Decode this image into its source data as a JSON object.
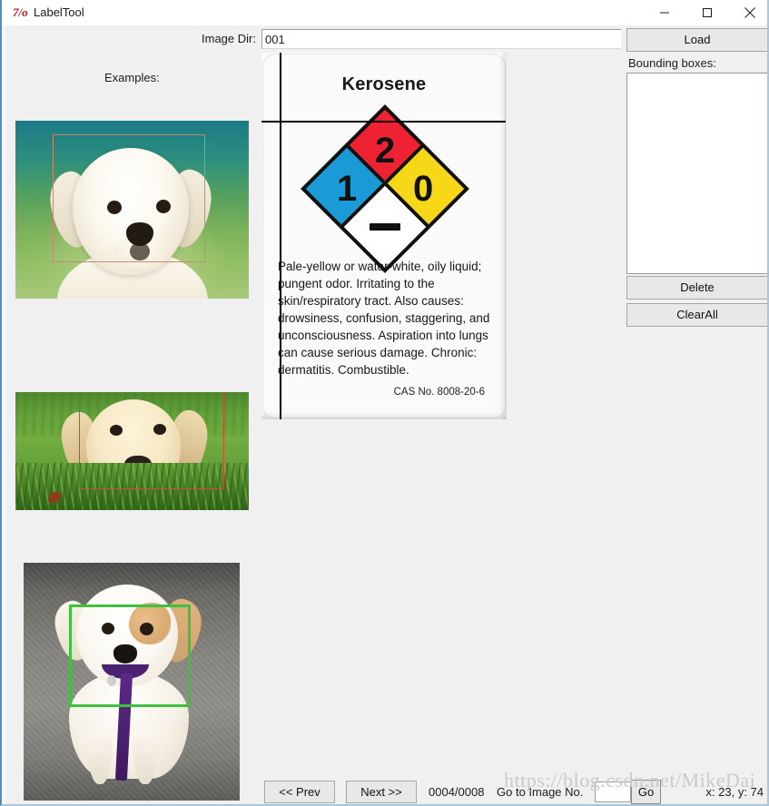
{
  "window": {
    "title": "LabelTool",
    "icon": "tk-logo-icon",
    "controls": {
      "minimize": "minimize-icon",
      "maximize": "maximize-icon",
      "close": "close-icon"
    }
  },
  "toolbar": {
    "dir_label": "Image Dir:",
    "dir_value": "001",
    "dir_placeholder": "",
    "load_label": "Load"
  },
  "examples": {
    "heading": "Examples:",
    "thumbnails": [
      {
        "name": "white-puppy-teal-background",
        "bbox_color": "#c98a6e",
        "alt": "White puppy on teal and green background with salmon bounding box around head"
      },
      {
        "name": "labrador-puppy-grass",
        "bbox_color": "#d4483c",
        "alt": "Yellow labrador puppy lying in grass with red bounding box around head"
      },
      {
        "name": "white-tan-puppy-pavement",
        "bbox_color": "#3ec13e",
        "alt": "White and tan puppy with purple leash sitting on pavement with green bounding box around head"
      }
    ]
  },
  "canvas": {
    "image_title": "Kerosene",
    "nfpa": {
      "health": "1",
      "fire": "2",
      "reactivity": "0",
      "special": "—",
      "health_color": "#1a9ad6",
      "fire_color": "#ee2233",
      "reactivity_color": "#f6d818",
      "special_color": "#ffffff"
    },
    "description": "Pale-yellow or water-white, oily liquid; pungent odor. Irritating to the skin/respiratory tract. Also causes: drowsiness, confusion, staggering, and unconsciousness. Aspiration into lungs can cause serious damage. Chronic: dermatitis. Combustible.",
    "cas": "CAS No. 8008-20-6"
  },
  "right_panel": {
    "bbox_label": "Bounding boxes:",
    "bbox_items": [],
    "delete_label": "Delete",
    "clearall_label": "ClearAll"
  },
  "bottom_bar": {
    "prev_label": "<< Prev",
    "next_label": "Next >>",
    "progress": "0004/0008",
    "goto_label": "Go to Image No.",
    "goto_value": "",
    "go_label": "Go",
    "coords": "x: 23, y: 74"
  },
  "watermark": {
    "text": "https://blog.csdn.net/MikeDai"
  }
}
